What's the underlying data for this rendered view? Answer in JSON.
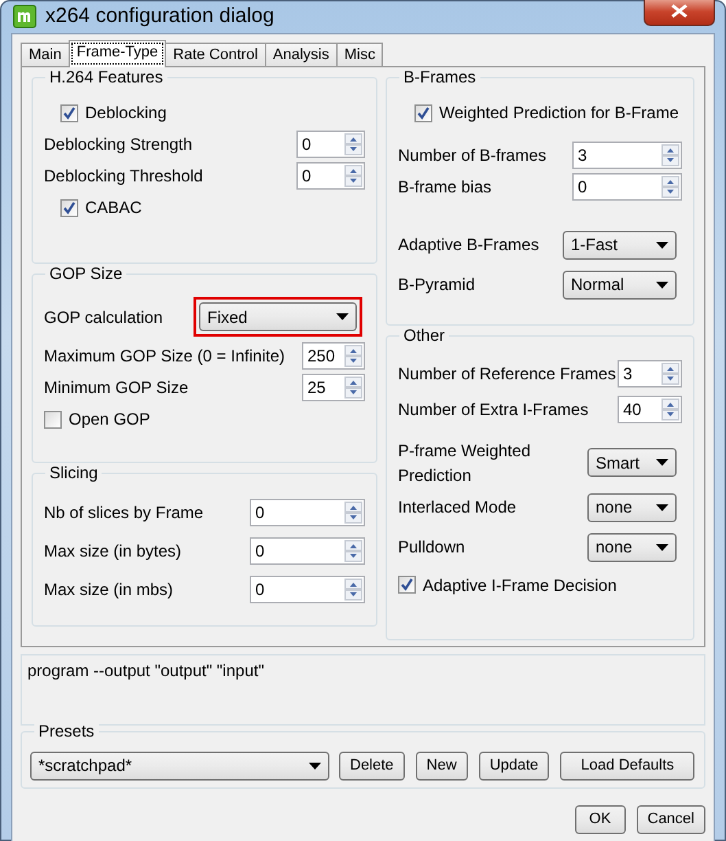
{
  "window": {
    "title": "x264 configuration dialog"
  },
  "tabs": [
    {
      "label": "Main",
      "selected": false
    },
    {
      "label": "Frame-Type",
      "selected": true
    },
    {
      "label": "Rate Control",
      "selected": false
    },
    {
      "label": "Analysis",
      "selected": false
    },
    {
      "label": "Misc",
      "selected": false
    }
  ],
  "columns": [
    [
      {
        "title": "H.264 Features",
        "items": [
          {
            "kind": "checkbox",
            "label": "Deblocking",
            "checked": true
          },
          {
            "kind": "spin",
            "label": "Deblocking Strength",
            "value": "0"
          },
          {
            "kind": "spin",
            "label": "Deblocking Threshold",
            "value": "0"
          },
          {
            "kind": "checkbox",
            "label": "CABAC",
            "checked": true
          }
        ]
      },
      {
        "title": "GOP Size",
        "items": [
          {
            "kind": "combo",
            "label": "GOP calculation",
            "value": "Fixed",
            "highlighted": true
          },
          {
            "kind": "spin",
            "label": "Maximum GOP Size (0 = Infinite)",
            "value": "250"
          },
          {
            "kind": "spin",
            "label": "Minimum GOP Size",
            "value": "25"
          },
          {
            "kind": "checkbox",
            "label": "Open GOP",
            "checked": false
          }
        ]
      },
      {
        "title": "Slicing",
        "items": [
          {
            "kind": "spin",
            "label": "Nb of slices by Frame",
            "value": "0"
          },
          {
            "kind": "spin",
            "label": "Max size (in bytes)",
            "value": "0"
          },
          {
            "kind": "spin",
            "label": "Max size (in mbs)",
            "value": "0"
          }
        ]
      }
    ],
    [
      {
        "title": "B-Frames",
        "items": [
          {
            "kind": "checkbox",
            "label": "Weighted Prediction for B-Frame",
            "checked": true
          },
          {
            "kind": "spin",
            "label": "Number of B-frames",
            "value": "3"
          },
          {
            "kind": "spin",
            "label": "B-frame bias",
            "value": "0"
          },
          {
            "kind": "combo",
            "label": "Adaptive B-Frames",
            "value": "1-Fast",
            "highlighted": false
          },
          {
            "kind": "combo",
            "label": "B-Pyramid",
            "value": "Normal",
            "highlighted": false
          }
        ]
      },
      {
        "title": "Other",
        "items": [
          {
            "kind": "spin",
            "label": "Number of Reference Frames",
            "value": "3"
          },
          {
            "kind": "spin",
            "label": "Number of Extra I-Frames",
            "value": "40"
          },
          {
            "kind": "combo",
            "label": "P-frame Weighted Prediction",
            "value": "Smart",
            "highlighted": false
          },
          {
            "kind": "combo",
            "label": "Interlaced Mode",
            "value": "none",
            "highlighted": false
          },
          {
            "kind": "combo",
            "label": "Pulldown",
            "value": "none",
            "highlighted": false
          },
          {
            "kind": "checkbox",
            "label": "Adaptive I-Frame Decision",
            "checked": true
          }
        ]
      }
    ]
  ],
  "command_line": "program --output \"output\" \"input\"",
  "presets": {
    "title": "Presets",
    "value": "*scratchpad*",
    "buttons": [
      "Delete",
      "New",
      "Update",
      "Load Defaults"
    ]
  },
  "buttons": [
    "OK",
    "Cancel"
  ]
}
